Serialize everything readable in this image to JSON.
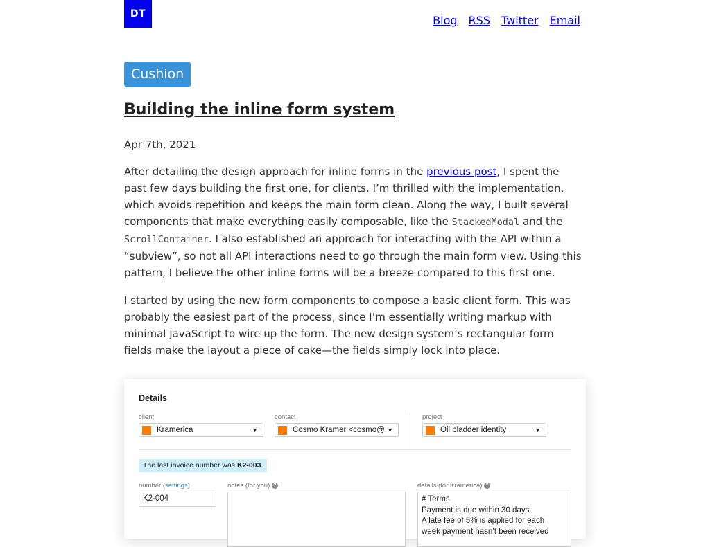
{
  "header": {
    "logo": "DT",
    "nav": [
      "Blog",
      "RSS",
      "Twitter",
      "Email"
    ]
  },
  "post": {
    "tag": "Cushion",
    "title": "Building the inline form system",
    "date": "Apr 7th, 2021",
    "p1": {
      "t1": "After detailing the design approach for inline forms in the ",
      "link": "previous post",
      "t2": ", I spent the past few days building the first one, for clients. I’m thrilled with the implementation, which avoids repetition and keeps the main form clean. Along the way, I built several components that make everything easily composable, like the ",
      "code1": "StackedModal",
      "t3": " and the ",
      "code2": "ScrollContainer",
      "t4": ". I also established an approach for interacting with the API within a “subview”, so not all API interactions need to go through the main form view. Using this pattern, I believe the other inline forms will be a breeze compared to this first one."
    },
    "p2": "I started by using the new form components to compose a basic client form. This was probably the easiest part of the process, since I’m essentially writing markup with minimal JavaScript to wire up the form. The new design system’s rectangular form fields make the layout a piece of cake—the fields simply lock into place."
  },
  "form": {
    "heading": "Details",
    "client": {
      "label": "client",
      "value": "Kramerica"
    },
    "contact": {
      "label": "contact",
      "value": "Cosmo Kramer <cosmo@"
    },
    "project": {
      "label": "project",
      "value": "Oil bladder identity"
    },
    "notice": {
      "text": "The last invoice number was ",
      "number": "K2-003",
      "end": "."
    },
    "number": {
      "label": "number",
      "settings": "settings",
      "value": "K2-004"
    },
    "notes": {
      "label": "notes (for you)"
    },
    "details": {
      "label": "details (for Kramerica)",
      "lines": [
        "# Terms",
        "Payment is due within 30 days.",
        "A late fee of 5% is applied for each",
        "week payment hasn’t been received"
      ]
    },
    "swatch_color": "#ff7a00",
    "help_icon": "question-circle-icon"
  },
  "colors": {
    "accent_link": "#0000ee",
    "tag_bg": "#3a92d9",
    "notice_bg": "#cdeefa"
  }
}
